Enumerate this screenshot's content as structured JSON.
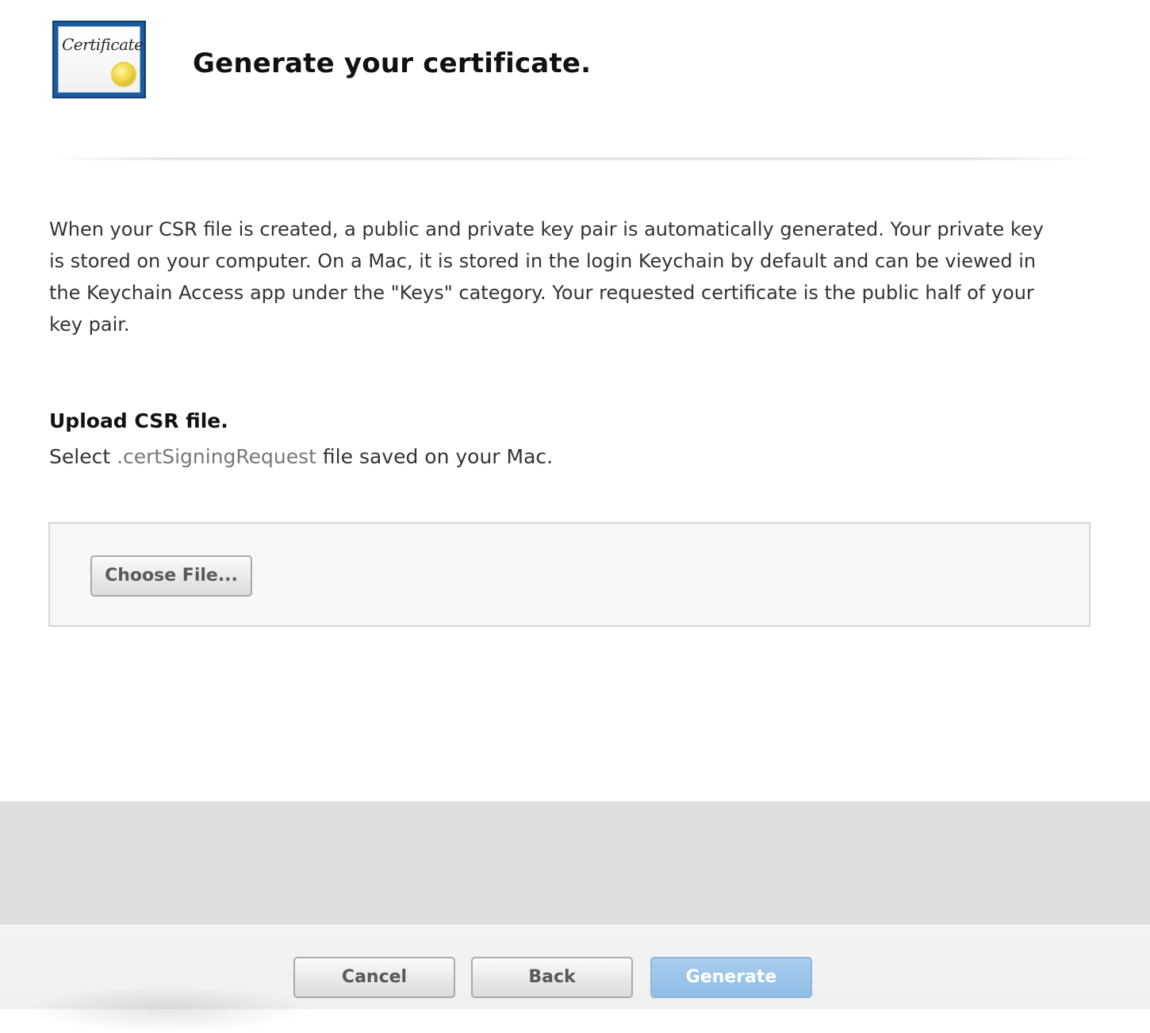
{
  "header": {
    "icon_name": "certificate-icon",
    "icon_script_text": "Certificate",
    "title": "Generate your certificate."
  },
  "main": {
    "description": "When your CSR file is created, a public and private key pair is automatically generated. Your private key is stored on your computer. On a Mac, it is stored in the login Keychain by default and can be viewed in the Keychain Access app under the \"Keys\" category. Your requested certificate is the public half of your key pair.",
    "upload": {
      "heading": "Upload CSR file.",
      "instruction_prefix": "Select ",
      "instruction_extension": ".certSigningRequest",
      "instruction_suffix": " file saved on your Mac.",
      "choose_file_label": "Choose File..."
    }
  },
  "footer": {
    "cancel_label": "Cancel",
    "back_label": "Back",
    "generate_label": "Generate"
  },
  "colors": {
    "generate_button": "#8fbde6",
    "footer_band": "#dedede"
  }
}
